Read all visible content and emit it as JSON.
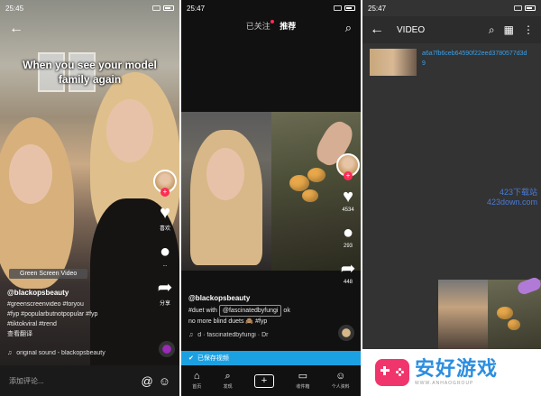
{
  "panel1": {
    "status": {
      "time": "25:45"
    },
    "caption": "When you see your model family again",
    "actions": [
      {
        "icon": "heart-icon",
        "label": "喜欢"
      },
      {
        "icon": "comment-icon",
        "label": "..."
      },
      {
        "icon": "share-icon",
        "label": "分享"
      }
    ],
    "green_screen_label": "Green Screen Video",
    "username": "@blackopsbeauty",
    "description": [
      "#greenscreenvideo #foryou",
      "#fyp #popularbutnotpopular #fyp",
      "#tiktokviral #trend",
      "查看翻译"
    ],
    "music": "original sound - blackopsbeauty",
    "comment_placeholder": "添加评论..."
  },
  "panel2": {
    "status": {
      "time": "25:47"
    },
    "tab_following": "已关注",
    "tab_recommended": "推荐",
    "side": {
      "likes": "4534",
      "comments": "293",
      "shares": "448"
    },
    "username": "@blackopsbeauty",
    "desc_prefix": "#duet with",
    "desc_chip": "@fascinatedbyfungi",
    "desc_suffix": "ok",
    "desc_line2": "no more blind duets 🙈 #fyp",
    "music": "d · fascinatedbyfungi · Dr",
    "save_banner": "已保存视频",
    "nav": [
      {
        "icon": "home-icon",
        "label": "首页"
      },
      {
        "icon": "discover-icon",
        "label": "发现"
      },
      {
        "icon": "add-icon",
        "label": ""
      },
      {
        "icon": "inbox-icon",
        "label": "收件箱"
      },
      {
        "icon": "profile-icon",
        "label": "个人资料"
      }
    ]
  },
  "panel3": {
    "status": {
      "time": "25:47"
    },
    "title": "VIDEO",
    "file_name": "a6a7fb6ceb64590f22eed3780577d3d9",
    "watermark_top": "423下载站",
    "watermark_bottom": "423down.com"
  },
  "brand": {
    "name": "安好游戏",
    "url": "WWW.ANHAOGROUP"
  },
  "colors": {
    "tiktok_red": "#fe2c55",
    "save_blue": "#1ba1e2",
    "link_blue": "#3aa0e8",
    "brand_pink": "#f0356c",
    "brand_blue": "#2b8ee0"
  }
}
